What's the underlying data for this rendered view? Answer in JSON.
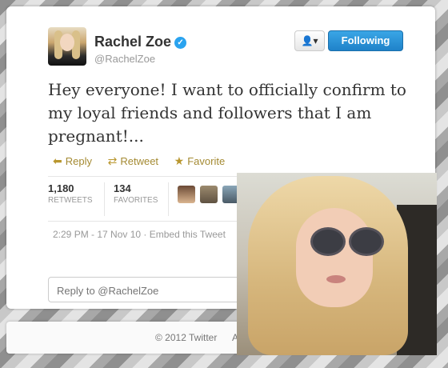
{
  "profile": {
    "name": "Rachel Zoe",
    "handle": "@RachelZoe",
    "verified_icon": "verified-check-icon",
    "follow_label": "Following",
    "user_dropdown_icon": "user-dropdown-icon"
  },
  "tweet": {
    "text": "Hey everyone! I want to officially confirm to my loyal friends and followers that I am pregnant!...",
    "actions": {
      "reply": "Reply",
      "retweet": "Retweet",
      "favorite": "Favorite"
    },
    "stats": {
      "retweets_count": "1,180",
      "retweets_label": "RETWEETS",
      "favorites_count": "134",
      "favorites_label": "FAVORITES"
    },
    "timestamp": "2:29 PM - 17 Nov 10",
    "embed_label": "Embed this Tweet"
  },
  "reply_box": {
    "placeholder": "Reply to @RachelZoe"
  },
  "footer": {
    "copyright": "© 2012 Twitter",
    "link": "Ab"
  },
  "colors": {
    "accent_blue": "#2a8fd8",
    "action_gold": "#a48a32"
  }
}
